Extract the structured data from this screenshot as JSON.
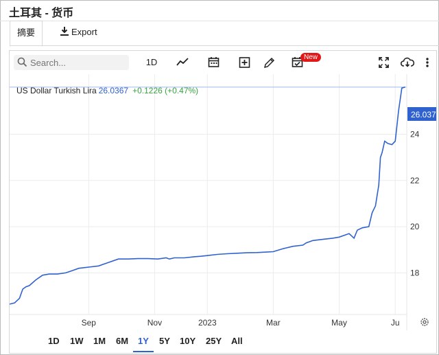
{
  "window": {
    "title": "土耳其 - 货币"
  },
  "tabs": [
    {
      "label": "摘要",
      "active": true
    },
    {
      "label": "Export",
      "icon": "download-icon"
    }
  ],
  "toolbar": {
    "search_placeholder": "Search...",
    "interval": "1D",
    "icons": [
      "chart-type-icon",
      "calendar-icon",
      "add-series-icon",
      "draw-pencil-icon",
      "event-calendar-icon",
      "fullscreen-icon",
      "cloud-download-icon",
      "more-vert-icon"
    ],
    "new_badge": "New"
  },
  "legend": {
    "name": "US Dollar Turkish Lira",
    "price": "26.0367",
    "change": "+0.1226 (+0.47%)"
  },
  "price_label": "26.037",
  "ranges": [
    "1D",
    "1W",
    "1M",
    "6M",
    "1Y",
    "5Y",
    "10Y",
    "25Y",
    "All"
  ],
  "active_range": "1Y",
  "colors": {
    "line": "#2f62cf",
    "accent": "#2f62cf",
    "change_up": "#36a53f",
    "badge": "#e01818"
  },
  "chart_data": {
    "type": "line",
    "title": "",
    "xlabel": "",
    "ylabel": "",
    "x_ticks": [
      "Sep",
      "Nov",
      "2023",
      "Mar",
      "May",
      "Ju"
    ],
    "x_tick_positions": [
      1.4,
      3.4,
      5.0,
      7.0,
      9.0,
      10.7
    ],
    "y_ticks": [
      18,
      20,
      22,
      24
    ],
    "ylim": [
      16.2,
      26.6
    ],
    "xlim": [
      -1.0,
      11.05
    ],
    "last_value": 26.037,
    "grid": true,
    "series": [
      {
        "x": [
          -1.0,
          -0.85,
          -0.7,
          -0.6,
          -0.5,
          -0.4,
          -0.2,
          0.0,
          0.2,
          0.45,
          0.7,
          0.9,
          1.1,
          1.4,
          1.7,
          2.0,
          2.3,
          2.6,
          2.9,
          3.2,
          3.5,
          3.75,
          3.85,
          4.0,
          4.3,
          4.6,
          4.8,
          5.0,
          5.3,
          5.6,
          5.9,
          6.2,
          6.5,
          6.8,
          7.0,
          7.3,
          7.6,
          7.9,
          8.0,
          8.2,
          8.5,
          8.8,
          9.0,
          9.3,
          9.45,
          9.55,
          9.7,
          9.9,
          10.0,
          10.1,
          10.2,
          10.25,
          10.3,
          10.38,
          10.48,
          10.6,
          10.7,
          10.8,
          10.9,
          11.0
        ],
        "y": [
          16.65,
          16.7,
          16.9,
          17.3,
          17.4,
          17.45,
          17.7,
          17.9,
          17.95,
          17.95,
          18.0,
          18.1,
          18.2,
          18.25,
          18.3,
          18.45,
          18.6,
          18.6,
          18.62,
          18.62,
          18.6,
          18.65,
          18.6,
          18.65,
          18.65,
          18.7,
          18.72,
          18.75,
          18.8,
          18.83,
          18.85,
          18.87,
          18.88,
          18.9,
          18.92,
          19.05,
          19.15,
          19.2,
          19.3,
          19.4,
          19.45,
          19.5,
          19.55,
          19.7,
          19.5,
          19.85,
          19.95,
          20.0,
          20.6,
          20.9,
          21.8,
          23.0,
          23.2,
          23.7,
          23.6,
          23.55,
          23.7,
          25.0,
          26.0,
          26.04
        ]
      }
    ]
  }
}
